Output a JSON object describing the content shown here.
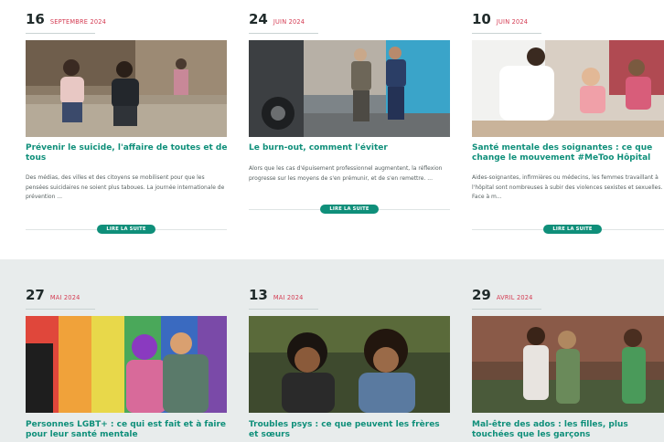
{
  "articles_row1": [
    {
      "day": "16",
      "month": "SEPTEMBRE 2024",
      "title": "Prévenir le suicide, l'affaire de toutes et de tous",
      "excerpt": "Des médias, des villes et des citoyens se mobilisent pour que les pensées suicidaires ne soient plus taboues. La journée internationale de prévention ...",
      "button": "LIRE LA SUITE"
    },
    {
      "day": "24",
      "month": "JUIN 2024",
      "title": "Le burn-out, comment l'éviter",
      "excerpt": "Alors que les cas d'épuisement professionnel augmentent, la réflexion progresse sur les moyens de s'en prémunir, et de s'en remettre. ...",
      "button": "LIRE LA SUITE"
    },
    {
      "day": "10",
      "month": "JUIN 2024",
      "title": "Santé mentale des soignantes : ce que change le mouvement #MeToo Hôpital",
      "excerpt": "Aides-soignantes, infirmières ou médecins, les femmes travaillant à l'hôpital sont nombreuses à subir des violences sexistes et sexuelles. Face à m...",
      "button": "LIRE LA SUITE"
    }
  ],
  "articles_row2": [
    {
      "day": "27",
      "month": "MAI 2024",
      "title": "Personnes LGBT+ : ce qui est fait et à faire pour leur santé mentale"
    },
    {
      "day": "13",
      "month": "MAI 2024",
      "title": "Troubles psys : ce que peuvent les frères et sœurs"
    },
    {
      "day": "29",
      "month": "AVRIL 2024",
      "title": "Mal-être des ados : les filles, plus touchées que les garçons"
    }
  ],
  "colors": {
    "accent_green": "#0f8f7a",
    "date_red": "#d43b52",
    "row2_background": "#e8ecec"
  }
}
